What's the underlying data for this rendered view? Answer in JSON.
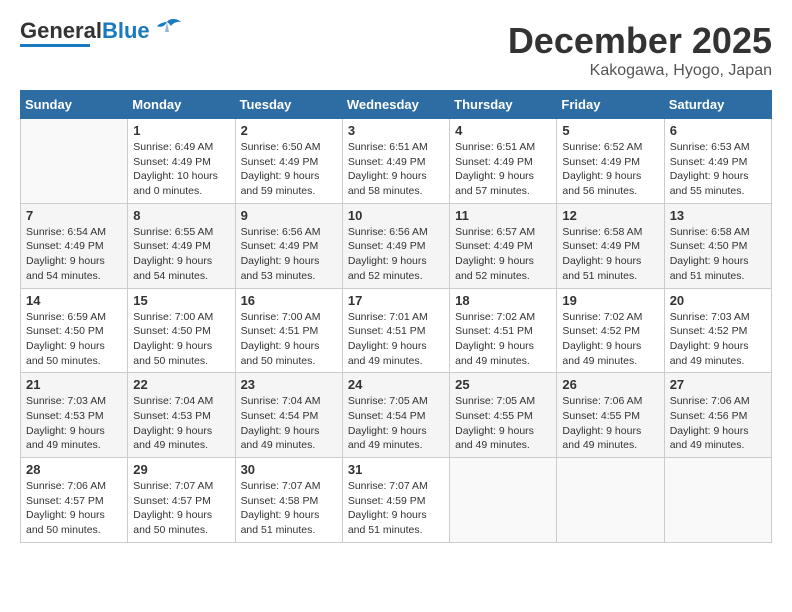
{
  "header": {
    "logo": {
      "line1": "General",
      "line2": "Blue"
    },
    "title": "December 2025",
    "location": "Kakogawa, Hyogo, Japan"
  },
  "days_of_week": [
    "Sunday",
    "Monday",
    "Tuesday",
    "Wednesday",
    "Thursday",
    "Friday",
    "Saturday"
  ],
  "weeks": [
    [
      {
        "day": "",
        "info": ""
      },
      {
        "day": "1",
        "info": "Sunrise: 6:49 AM\nSunset: 4:49 PM\nDaylight: 10 hours\nand 0 minutes."
      },
      {
        "day": "2",
        "info": "Sunrise: 6:50 AM\nSunset: 4:49 PM\nDaylight: 9 hours\nand 59 minutes."
      },
      {
        "day": "3",
        "info": "Sunrise: 6:51 AM\nSunset: 4:49 PM\nDaylight: 9 hours\nand 58 minutes."
      },
      {
        "day": "4",
        "info": "Sunrise: 6:51 AM\nSunset: 4:49 PM\nDaylight: 9 hours\nand 57 minutes."
      },
      {
        "day": "5",
        "info": "Sunrise: 6:52 AM\nSunset: 4:49 PM\nDaylight: 9 hours\nand 56 minutes."
      },
      {
        "day": "6",
        "info": "Sunrise: 6:53 AM\nSunset: 4:49 PM\nDaylight: 9 hours\nand 55 minutes."
      }
    ],
    [
      {
        "day": "7",
        "info": "Sunrise: 6:54 AM\nSunset: 4:49 PM\nDaylight: 9 hours\nand 54 minutes."
      },
      {
        "day": "8",
        "info": "Sunrise: 6:55 AM\nSunset: 4:49 PM\nDaylight: 9 hours\nand 54 minutes."
      },
      {
        "day": "9",
        "info": "Sunrise: 6:56 AM\nSunset: 4:49 PM\nDaylight: 9 hours\nand 53 minutes."
      },
      {
        "day": "10",
        "info": "Sunrise: 6:56 AM\nSunset: 4:49 PM\nDaylight: 9 hours\nand 52 minutes."
      },
      {
        "day": "11",
        "info": "Sunrise: 6:57 AM\nSunset: 4:49 PM\nDaylight: 9 hours\nand 52 minutes."
      },
      {
        "day": "12",
        "info": "Sunrise: 6:58 AM\nSunset: 4:49 PM\nDaylight: 9 hours\nand 51 minutes."
      },
      {
        "day": "13",
        "info": "Sunrise: 6:58 AM\nSunset: 4:50 PM\nDaylight: 9 hours\nand 51 minutes."
      }
    ],
    [
      {
        "day": "14",
        "info": "Sunrise: 6:59 AM\nSunset: 4:50 PM\nDaylight: 9 hours\nand 50 minutes."
      },
      {
        "day": "15",
        "info": "Sunrise: 7:00 AM\nSunset: 4:50 PM\nDaylight: 9 hours\nand 50 minutes."
      },
      {
        "day": "16",
        "info": "Sunrise: 7:00 AM\nSunset: 4:51 PM\nDaylight: 9 hours\nand 50 minutes."
      },
      {
        "day": "17",
        "info": "Sunrise: 7:01 AM\nSunset: 4:51 PM\nDaylight: 9 hours\nand 49 minutes."
      },
      {
        "day": "18",
        "info": "Sunrise: 7:02 AM\nSunset: 4:51 PM\nDaylight: 9 hours\nand 49 minutes."
      },
      {
        "day": "19",
        "info": "Sunrise: 7:02 AM\nSunset: 4:52 PM\nDaylight: 9 hours\nand 49 minutes."
      },
      {
        "day": "20",
        "info": "Sunrise: 7:03 AM\nSunset: 4:52 PM\nDaylight: 9 hours\nand 49 minutes."
      }
    ],
    [
      {
        "day": "21",
        "info": "Sunrise: 7:03 AM\nSunset: 4:53 PM\nDaylight: 9 hours\nand 49 minutes."
      },
      {
        "day": "22",
        "info": "Sunrise: 7:04 AM\nSunset: 4:53 PM\nDaylight: 9 hours\nand 49 minutes."
      },
      {
        "day": "23",
        "info": "Sunrise: 7:04 AM\nSunset: 4:54 PM\nDaylight: 9 hours\nand 49 minutes."
      },
      {
        "day": "24",
        "info": "Sunrise: 7:05 AM\nSunset: 4:54 PM\nDaylight: 9 hours\nand 49 minutes."
      },
      {
        "day": "25",
        "info": "Sunrise: 7:05 AM\nSunset: 4:55 PM\nDaylight: 9 hours\nand 49 minutes."
      },
      {
        "day": "26",
        "info": "Sunrise: 7:06 AM\nSunset: 4:55 PM\nDaylight: 9 hours\nand 49 minutes."
      },
      {
        "day": "27",
        "info": "Sunrise: 7:06 AM\nSunset: 4:56 PM\nDaylight: 9 hours\nand 49 minutes."
      }
    ],
    [
      {
        "day": "28",
        "info": "Sunrise: 7:06 AM\nSunset: 4:57 PM\nDaylight: 9 hours\nand 50 minutes."
      },
      {
        "day": "29",
        "info": "Sunrise: 7:07 AM\nSunset: 4:57 PM\nDaylight: 9 hours\nand 50 minutes."
      },
      {
        "day": "30",
        "info": "Sunrise: 7:07 AM\nSunset: 4:58 PM\nDaylight: 9 hours\nand 51 minutes."
      },
      {
        "day": "31",
        "info": "Sunrise: 7:07 AM\nSunset: 4:59 PM\nDaylight: 9 hours\nand 51 minutes."
      },
      {
        "day": "",
        "info": ""
      },
      {
        "day": "",
        "info": ""
      },
      {
        "day": "",
        "info": ""
      }
    ]
  ]
}
